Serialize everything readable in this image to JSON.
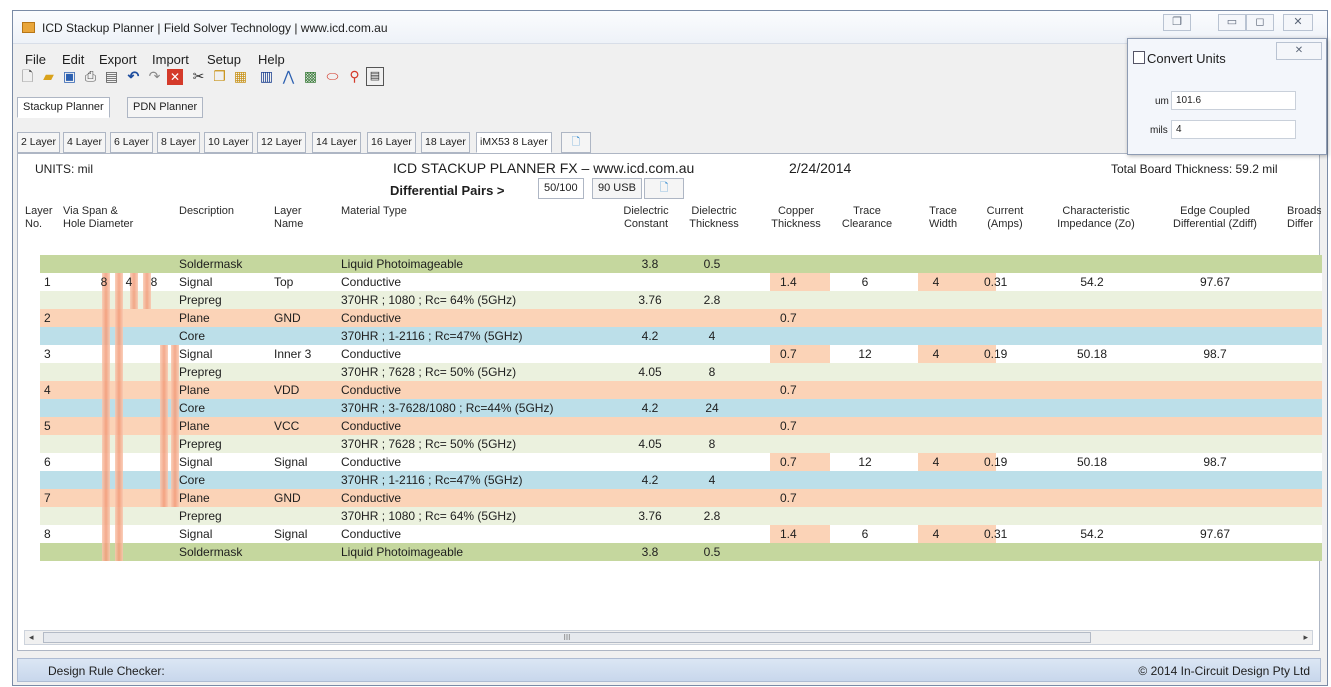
{
  "window": {
    "title": "ICD Stackup Planner | Field Solver Technology | www.icd.com.au",
    "controls": [
      "❐",
      "▭",
      "◻",
      "✕"
    ]
  },
  "menu": [
    "File",
    "Edit",
    "Export",
    "Import",
    "Setup",
    "Help"
  ],
  "toolbar_icons": [
    "new-file-icon",
    "open-folder-icon",
    "save-icon",
    "print-icon",
    "print-preview-icon",
    "undo-icon",
    "redo-icon",
    "delete-icon",
    "cut-icon",
    "copy-icon",
    "paste-icon",
    "columns-icon",
    "chart-icon",
    "calculator-icon",
    "via-icon",
    "pin-icon",
    "convert-units-icon"
  ],
  "main_tabs": [
    "Stackup Planner",
    "PDN Planner"
  ],
  "layer_tabs": [
    "2 Layer",
    "4 Layer",
    "6 Layer",
    "8 Layer",
    "10 Layer",
    "12 Layer",
    "14 Layer",
    "16 Layer",
    "18 Layer",
    "iMX53 8 Layer"
  ],
  "header": {
    "units": "UNITS: mil",
    "title": "ICD STACKUP PLANNER FX – www.icd.com.au",
    "date": "2/24/2014",
    "thickness": "Total Board Thickness: 59.2 mil",
    "diff_label": "Differential Pairs >",
    "diff_tabs": [
      "50/100",
      "90 USB"
    ]
  },
  "columns": [
    "Layer\nNo.",
    "Via Span &\nHole Diameter",
    "Description",
    "Layer\nName",
    "Material Type",
    "Dielectric\nConstant",
    "Dielectric\nThickness",
    "Copper\nThickness",
    "Trace\nClearance",
    "Trace\nWidth",
    "Current\n(Amps)",
    "Characteristic\nImpedance (Zo)",
    "Edge Coupled\nDifferential (Zdiff)",
    "Broads\nDiffer"
  ],
  "colors": {
    "soldermask": "#c5d79e",
    "signal": "#ffffff",
    "prepreg": "#ebf1de",
    "plane": "#fbd3b7",
    "core": "#bcdfe9",
    "copper_cell": "#fbd3b7",
    "via_a": "#f29a78",
    "via_b": "#f9c7ae"
  },
  "rows": [
    {
      "type": "soldermask",
      "layer": "",
      "via": [
        "",
        "",
        ""
      ],
      "desc": "Soldermask",
      "name": "",
      "material": "Liquid Photoimageable",
      "dk": "3.8",
      "dthick": "0.5",
      "cu": "",
      "clear": "",
      "width": "",
      "current": "",
      "zo": "",
      "zdiff": ""
    },
    {
      "type": "signal",
      "layer": "1",
      "via": [
        "8",
        "4",
        "8"
      ],
      "desc": "Signal",
      "name": "Top",
      "material": "Conductive",
      "dk": "",
      "dthick": "",
      "cu": "1.4",
      "clear": "6",
      "width": "4",
      "current": "0.31",
      "zo": "54.2",
      "zdiff": "97.67"
    },
    {
      "type": "prepreg",
      "layer": "",
      "via": [
        "",
        "",
        ""
      ],
      "desc": "Prepreg",
      "name": "",
      "material": "370HR ; 1080 ; Rc= 64% (5GHz)",
      "dk": "3.76",
      "dthick": "2.8",
      "cu": "",
      "clear": "",
      "width": "",
      "current": "",
      "zo": "",
      "zdiff": ""
    },
    {
      "type": "plane",
      "layer": "2",
      "via": [
        "",
        "",
        ""
      ],
      "desc": "Plane",
      "name": "GND",
      "material": "Conductive",
      "dk": "",
      "dthick": "",
      "cu": "0.7",
      "clear": "",
      "width": "",
      "current": "",
      "zo": "",
      "zdiff": ""
    },
    {
      "type": "core",
      "layer": "",
      "via": [
        "",
        "",
        ""
      ],
      "desc": "Core",
      "name": "",
      "material": "370HR ; 1-2116 ; Rc=47% (5GHz)",
      "dk": "4.2",
      "dthick": "4",
      "cu": "",
      "clear": "",
      "width": "",
      "current": "",
      "zo": "",
      "zdiff": ""
    },
    {
      "type": "signal",
      "layer": "3",
      "via": [
        "",
        "",
        ""
      ],
      "desc": "Signal",
      "name": "Inner 3",
      "material": "Conductive",
      "dk": "",
      "dthick": "",
      "cu": "0.7",
      "clear": "12",
      "width": "4",
      "current": "0.19",
      "zo": "50.18",
      "zdiff": "98.7"
    },
    {
      "type": "prepreg",
      "layer": "",
      "via": [
        "",
        "",
        ""
      ],
      "desc": "Prepreg",
      "name": "",
      "material": "370HR ; 7628 ; Rc= 50% (5GHz)",
      "dk": "4.05",
      "dthick": "8",
      "cu": "",
      "clear": "",
      "width": "",
      "current": "",
      "zo": "",
      "zdiff": ""
    },
    {
      "type": "plane",
      "layer": "4",
      "via": [
        "",
        "",
        ""
      ],
      "desc": "Plane",
      "name": "VDD",
      "material": "Conductive",
      "dk": "",
      "dthick": "",
      "cu": "0.7",
      "clear": "",
      "width": "",
      "current": "",
      "zo": "",
      "zdiff": ""
    },
    {
      "type": "core",
      "layer": "",
      "via": [
        "",
        "",
        ""
      ],
      "desc": "Core",
      "name": "",
      "material": "370HR ; 3-7628/1080 ; Rc=44% (5GHz)",
      "dk": "4.2",
      "dthick": "24",
      "cu": "",
      "clear": "",
      "width": "",
      "current": "",
      "zo": "",
      "zdiff": ""
    },
    {
      "type": "plane",
      "layer": "5",
      "via": [
        "",
        "",
        ""
      ],
      "desc": "Plane",
      "name": "VCC",
      "material": "Conductive",
      "dk": "",
      "dthick": "",
      "cu": "0.7",
      "clear": "",
      "width": "",
      "current": "",
      "zo": "",
      "zdiff": ""
    },
    {
      "type": "prepreg",
      "layer": "",
      "via": [
        "",
        "",
        ""
      ],
      "desc": "Prepreg",
      "name": "",
      "material": "370HR ; 7628 ; Rc= 50% (5GHz)",
      "dk": "4.05",
      "dthick": "8",
      "cu": "",
      "clear": "",
      "width": "",
      "current": "",
      "zo": "",
      "zdiff": ""
    },
    {
      "type": "signal",
      "layer": "6",
      "via": [
        "",
        "",
        ""
      ],
      "desc": "Signal",
      "name": "Signal",
      "material": "Conductive",
      "dk": "",
      "dthick": "",
      "cu": "0.7",
      "clear": "12",
      "width": "4",
      "current": "0.19",
      "zo": "50.18",
      "zdiff": "98.7"
    },
    {
      "type": "core",
      "layer": "",
      "via": [
        "",
        "",
        ""
      ],
      "desc": "Core",
      "name": "",
      "material": "370HR ; 1-2116 ; Rc=47% (5GHz)",
      "dk": "4.2",
      "dthick": "4",
      "cu": "",
      "clear": "",
      "width": "",
      "current": "",
      "zo": "",
      "zdiff": ""
    },
    {
      "type": "plane",
      "layer": "7",
      "via": [
        "",
        "",
        ""
      ],
      "desc": "Plane",
      "name": "GND",
      "material": "Conductive",
      "dk": "",
      "dthick": "",
      "cu": "0.7",
      "clear": "",
      "width": "",
      "current": "",
      "zo": "",
      "zdiff": ""
    },
    {
      "type": "prepreg",
      "layer": "",
      "via": [
        "",
        "",
        ""
      ],
      "desc": "Prepreg",
      "name": "",
      "material": "370HR ; 1080 ; Rc= 64% (5GHz)",
      "dk": "3.76",
      "dthick": "2.8",
      "cu": "",
      "clear": "",
      "width": "",
      "current": "",
      "zo": "",
      "zdiff": ""
    },
    {
      "type": "signal",
      "layer": "8",
      "via": [
        "",
        "",
        ""
      ],
      "desc": "Signal",
      "name": "Signal",
      "material": "Conductive",
      "dk": "",
      "dthick": "",
      "cu": "1.4",
      "clear": "6",
      "width": "4",
      "current": "0.31",
      "zo": "54.2",
      "zdiff": "97.67"
    },
    {
      "type": "soldermask",
      "layer": "",
      "via": [
        "",
        "",
        ""
      ],
      "desc": "Soldermask",
      "name": "",
      "material": "Liquid Photoimageable",
      "dk": "3.8",
      "dthick": "0.5",
      "cu": "",
      "clear": "",
      "width": "",
      "current": "",
      "zo": "",
      "zdiff": ""
    }
  ],
  "scrollbar": {
    "left_arrow": "◂",
    "right_arrow": "▸",
    "grip": "III"
  },
  "status": {
    "left": "Design Rule Checker:",
    "right": "© 2014 In-Circuit Design Pty Ltd"
  },
  "convert_units": {
    "title": "Convert Units",
    "close": "✕",
    "um_label": "um",
    "um_value": "101.6",
    "mils_label": "mils",
    "mils_value": "4"
  }
}
